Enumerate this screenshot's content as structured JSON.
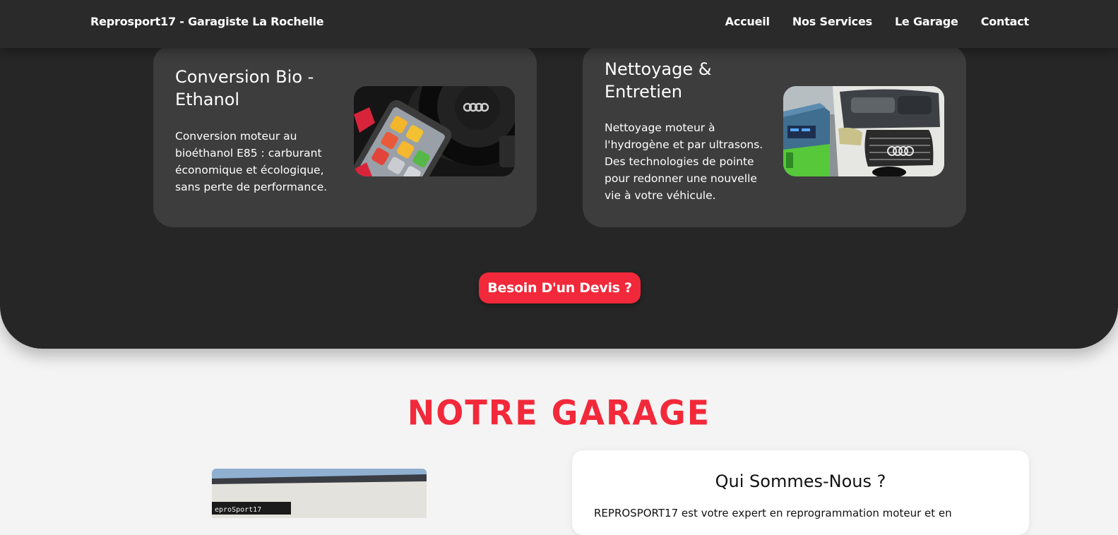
{
  "navbar": {
    "brand": "Reprosport17 - Garagiste La Rochelle",
    "links": [
      "Accueil",
      "Nos Services",
      "Le Garage",
      "Contact"
    ]
  },
  "services": [
    {
      "title": "Conversion Bio - Ethanol",
      "description": "Conversion moteur au bioéthanol E85 : carburant économique et écologique, sans perte de performance.",
      "image_alt": "diagnostic-tablet-in-audi-cockpit"
    },
    {
      "title": "Nettoyage & Entretien",
      "description": "Nettoyage moteur à l'hydrogène et par ultrasons. Des technologies de pointe pour redonner une nouvelle vie à votre véhicule.",
      "image_alt": "hydrogen-cleaning-machine-on-audi"
    }
  ],
  "cta": {
    "label": "Besoin D'un Devis ?"
  },
  "garage": {
    "title": "NOTRE GARAGE",
    "photo_sign": "eproSport17",
    "about_title": "Qui Sommes-Nous ?",
    "about_text": "REPROSPORT17 est votre expert en reprogrammation moteur et en"
  },
  "colors": {
    "accent": "#f2293a",
    "dark_bg": "#262626",
    "card_bg": "#3d3d3d",
    "page_bg": "#f4f4f4"
  }
}
